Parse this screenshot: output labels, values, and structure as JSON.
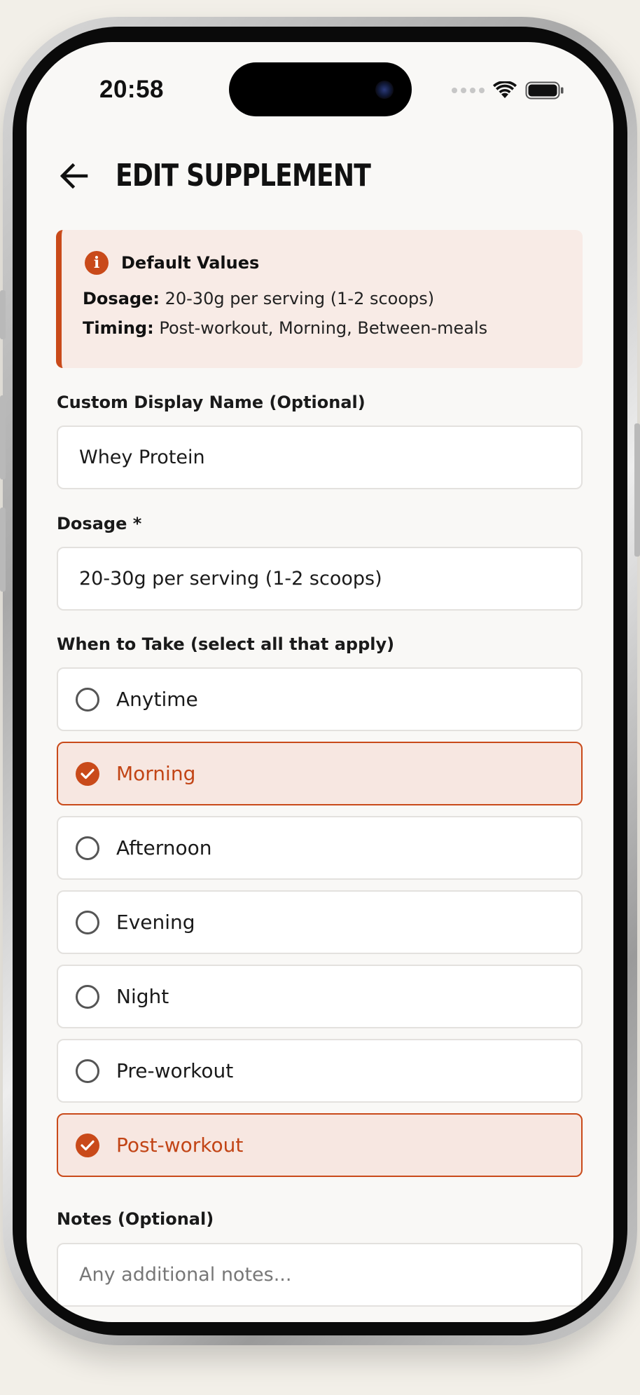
{
  "status_bar": {
    "time": "20:58"
  },
  "header": {
    "title": "EDIT SUPPLEMENT",
    "back_icon": "arrow-left-icon"
  },
  "info_box": {
    "icon": "info-icon",
    "icon_glyph": "i",
    "title": "Default Values",
    "dosage_label": "Dosage:",
    "dosage_value": "20-30g per serving (1-2 scoops)",
    "timing_label": "Timing:",
    "timing_value": "Post-workout, Morning, Between-meals"
  },
  "display_name": {
    "label": "Custom Display Name (Optional)",
    "value": "Whey Protein"
  },
  "dosage": {
    "label": "Dosage *",
    "value": "20-30g per serving (1-2 scoops)"
  },
  "when_to_take": {
    "label": "When to Take (select all that apply)",
    "options": [
      {
        "label": "Anytime",
        "selected": false
      },
      {
        "label": "Morning",
        "selected": true
      },
      {
        "label": "Afternoon",
        "selected": false
      },
      {
        "label": "Evening",
        "selected": false
      },
      {
        "label": "Night",
        "selected": false
      },
      {
        "label": "Pre-workout",
        "selected": false
      },
      {
        "label": "Post-workout",
        "selected": true
      }
    ]
  },
  "notes": {
    "label": "Notes (Optional)",
    "placeholder": "Any additional notes..."
  },
  "colors": {
    "accent": "#c94a1a",
    "selected_bg": "#f7e7e1",
    "info_bg": "#f8ebe6"
  }
}
